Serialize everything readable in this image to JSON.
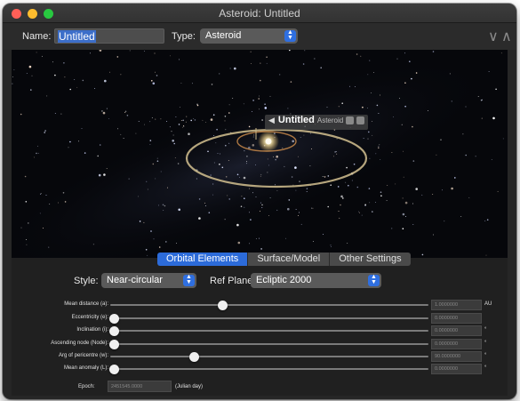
{
  "window": {
    "title": "Asteroid: Untitled"
  },
  "toolbar": {
    "name_label": "Name:",
    "name_value": "Untitled",
    "type_label": "Type:",
    "type_value": "Asteroid",
    "collapse_glyph": "∨",
    "expand_glyph": "∧"
  },
  "viewport": {
    "object_name": "Untitled",
    "object_kind": "Asteroid",
    "label_arrow": "◀"
  },
  "tabs": [
    {
      "label": "Orbital Elements",
      "active": true
    },
    {
      "label": "Surface/Model",
      "active": false
    },
    {
      "label": "Other Settings",
      "active": false
    }
  ],
  "orbital": {
    "style_label": "Style:",
    "style_value": "Near-circular",
    "ref_label": "Ref Plane:",
    "ref_value": "Ecliptic 2000",
    "rows": [
      {
        "label": "Mean distance (a):",
        "value": "1.0000000",
        "unit": "AU",
        "level": 0.34
      },
      {
        "label": "Eccentricity (e):",
        "value": "0.0000000",
        "unit": "",
        "level": 0.0
      },
      {
        "label": "Inclination (i):",
        "value": "0.0000000",
        "unit": "°",
        "level": 0.0
      },
      {
        "label": "Ascending node (Node):",
        "value": "0.0000000",
        "unit": "°",
        "level": 0.0
      },
      {
        "label": "Arg of pericentre (w):",
        "value": "90.0000000",
        "unit": "°",
        "level": 0.25
      },
      {
        "label": "Mean anomaly (L):",
        "value": "0.0000000",
        "unit": "°",
        "level": 0.0
      }
    ],
    "epoch_label": "Epoch:",
    "epoch_value": "2451545.0000",
    "epoch_unit": "(Julian day)"
  },
  "colors": {
    "accent": "#2c6bd9",
    "orbit": "#c9b78a",
    "sun": "#fff6d8"
  }
}
